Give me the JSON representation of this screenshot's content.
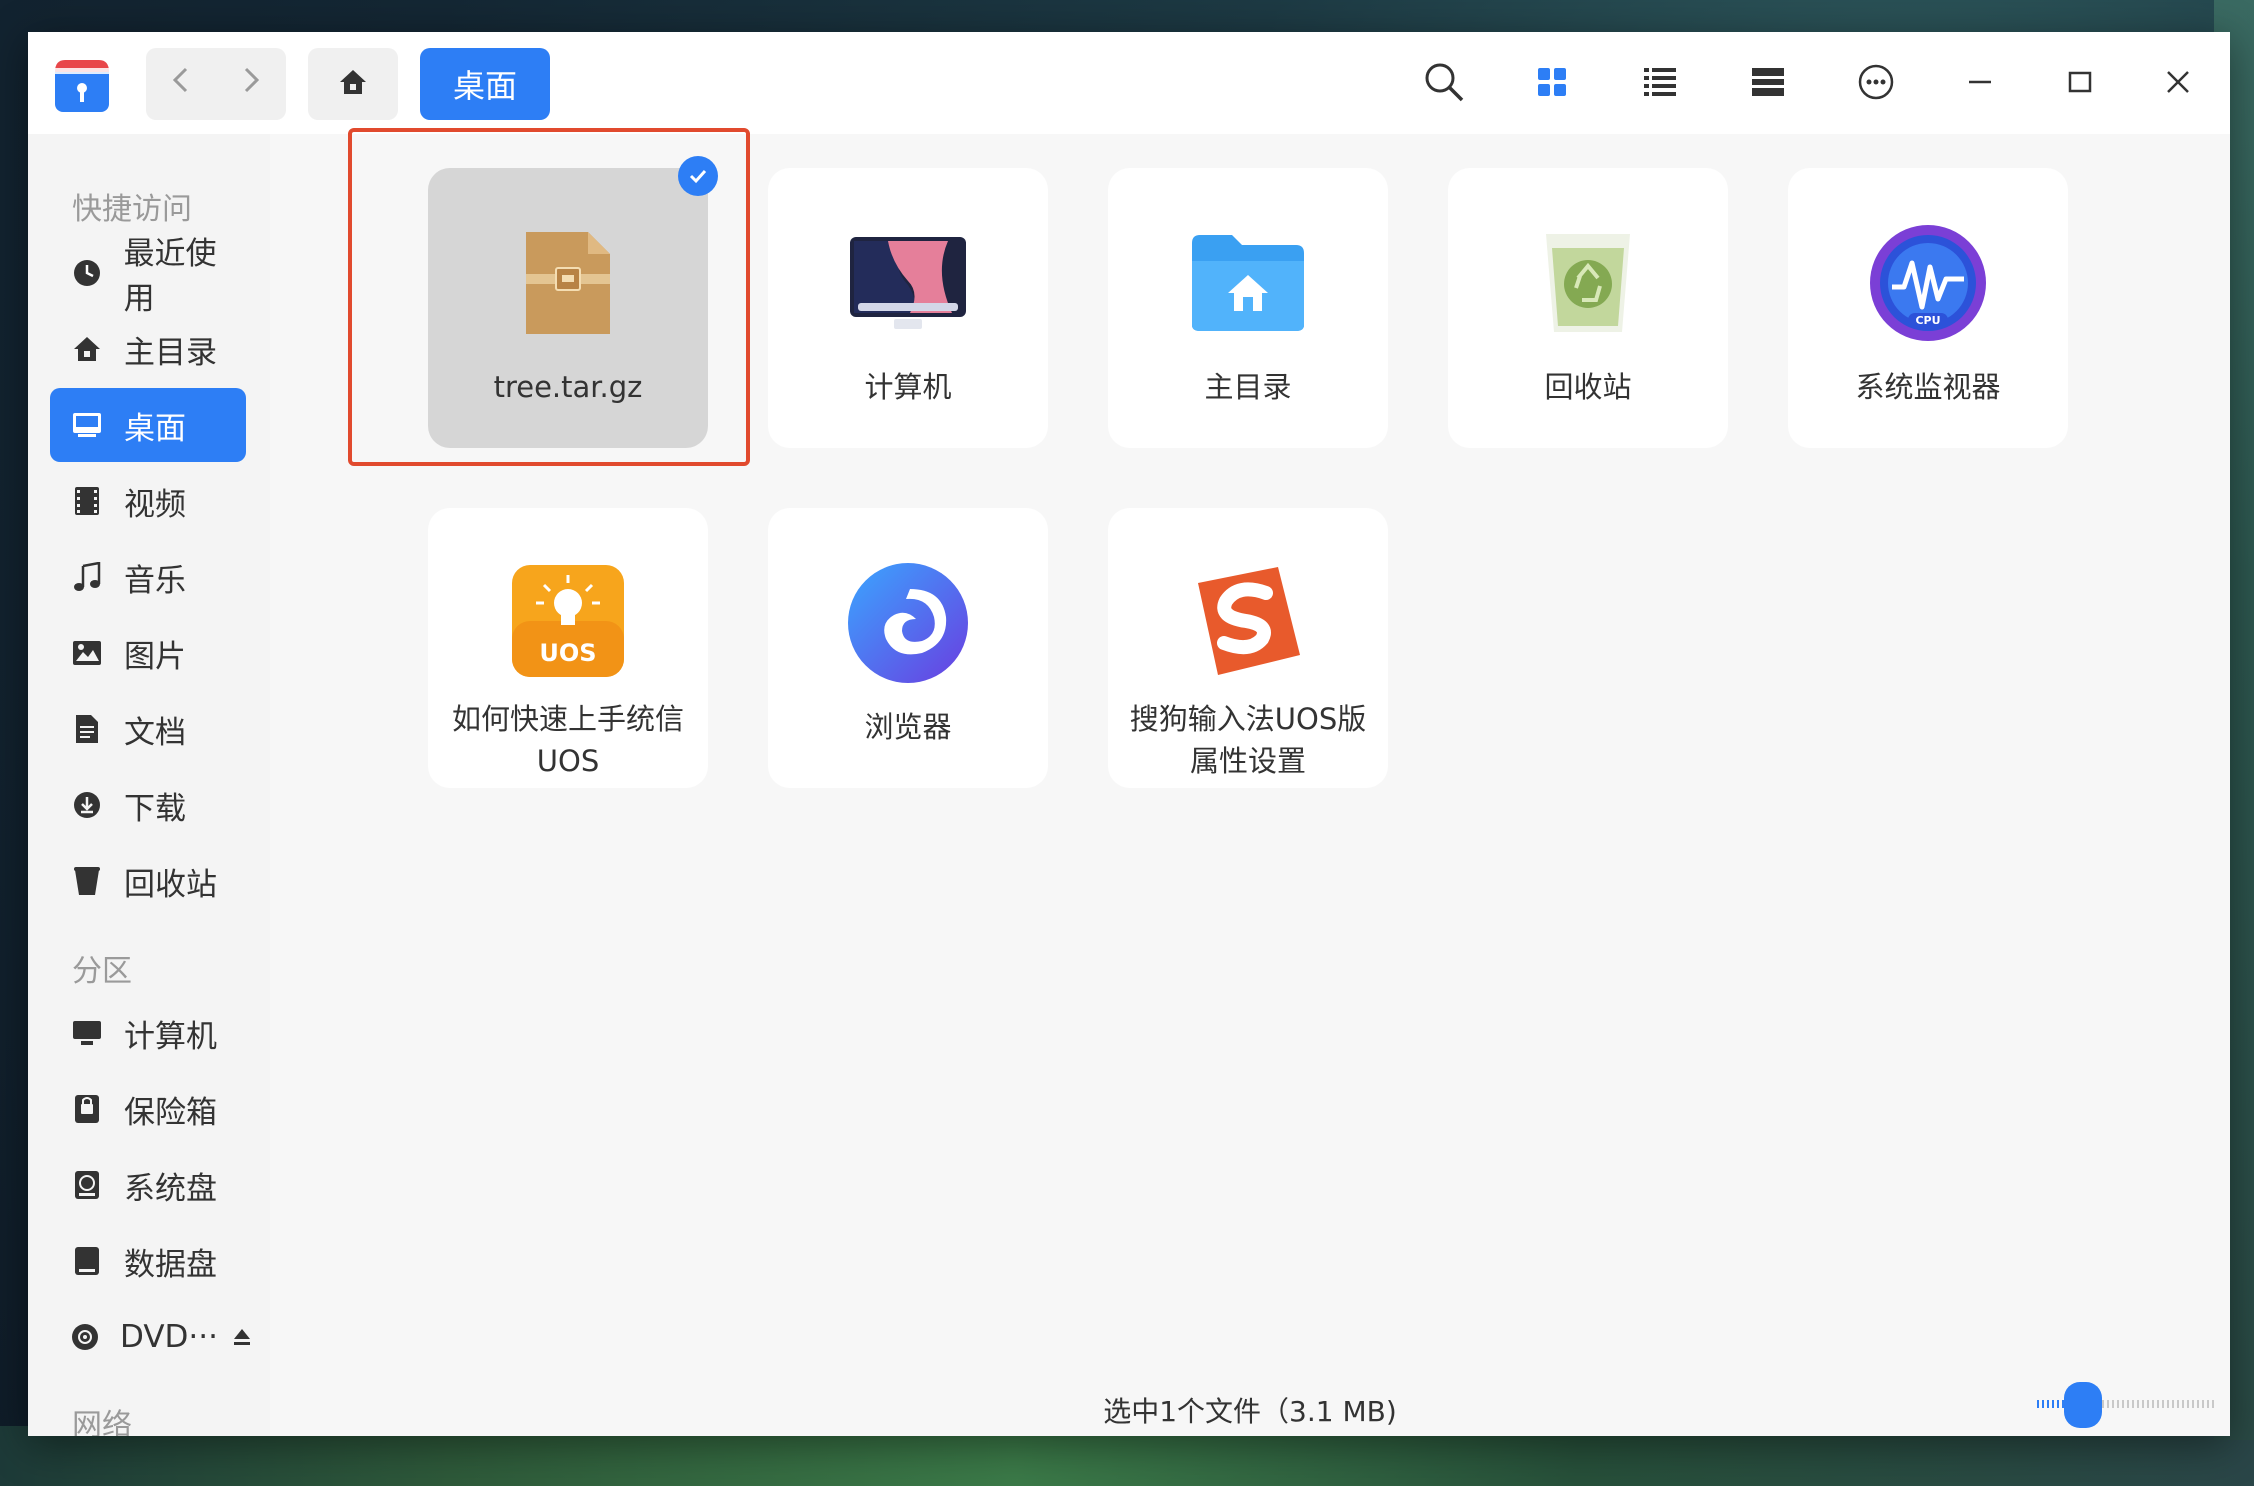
{
  "window": {
    "current_location": "桌面"
  },
  "toolbar": {
    "back_icon": "chevron-left-icon",
    "forward_icon": "chevron-right-icon",
    "home_icon": "home-icon",
    "search_icon": "search-icon",
    "icon_view_icon": "grid-view-icon",
    "list_view_icon": "list-view-icon",
    "tree_view_icon": "tree-view-icon",
    "menu_icon": "more-icon",
    "minimize_icon": "minimize-icon",
    "maximize_icon": "maximize-icon",
    "close_icon": "close-icon"
  },
  "sidebar": {
    "quick_access_header": "快捷访问",
    "quick_access": [
      {
        "label": "最近使用",
        "icon": "clock-icon"
      },
      {
        "label": "主目录",
        "icon": "home-icon"
      },
      {
        "label": "桌面",
        "icon": "desktop-icon"
      },
      {
        "label": "视频",
        "icon": "video-icon"
      },
      {
        "label": "音乐",
        "icon": "music-icon"
      },
      {
        "label": "图片",
        "icon": "image-icon"
      },
      {
        "label": "文档",
        "icon": "document-icon"
      },
      {
        "label": "下载",
        "icon": "download-icon"
      },
      {
        "label": "回收站",
        "icon": "trash-icon"
      }
    ],
    "partitions_header": "分区",
    "partitions": [
      {
        "label": "计算机",
        "icon": "computer-icon"
      },
      {
        "label": "保险箱",
        "icon": "vault-icon"
      },
      {
        "label": "系统盘",
        "icon": "system-disk-icon"
      },
      {
        "label": "数据盘",
        "icon": "data-disk-icon"
      },
      {
        "label": "DVD···",
        "icon": "dvd-icon",
        "eject_icon": "eject-icon"
      }
    ],
    "network_header": "网络"
  },
  "files": [
    {
      "label": "tree.tar.gz",
      "icon": "archive-icon",
      "selected": true
    },
    {
      "label": "计算机",
      "icon": "computer-app-icon"
    },
    {
      "label": "主目录",
      "icon": "home-folder-icon"
    },
    {
      "label": "回收站",
      "icon": "recycle-bin-icon"
    },
    {
      "label": "系统监视器",
      "icon": "system-monitor-icon"
    },
    {
      "label": "如何快速上手统信UOS",
      "icon": "uos-guide-icon"
    },
    {
      "label": "浏览器",
      "icon": "browser-icon"
    },
    {
      "label": "搜狗输入法UOS版属性设置",
      "icon": "sogou-icon"
    }
  ],
  "status_bar": {
    "text": "选中1个文件（3.1 MB)"
  },
  "zoom_slider": {
    "value_fraction": 0.2
  },
  "colors": {
    "accent": "#2d7ef5",
    "selection_frame": "#e14a2e"
  }
}
